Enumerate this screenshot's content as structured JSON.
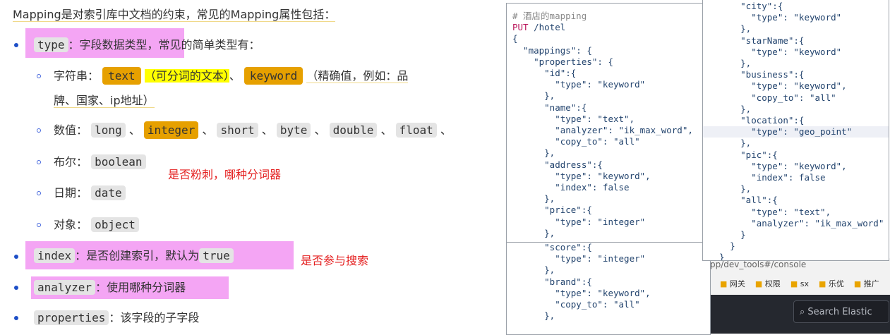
{
  "heading": "Mapping是对索引库中文档的约束，常见的Mapping属性包括：",
  "type_item": {
    "code": "type",
    "text": "：字段数据类型，常见的简单类型有："
  },
  "string_row": {
    "label": "字符串：",
    "text_code": "text",
    "text_note": "（可分词的文本）",
    "sep": "、",
    "keyword_code": "keyword",
    "keyword_note": "（精确值，例如：品",
    "keyword_note2": "牌、国家、ip地址）"
  },
  "number_row": {
    "label": "数值：",
    "types": [
      "long",
      "integer",
      "short",
      "byte",
      "double",
      "float"
    ],
    "sep": "、"
  },
  "bool_row": {
    "label": "布尔：",
    "code": "boolean",
    "note": "是否粉刺，哪种分词器"
  },
  "date_row": {
    "label": "日期：",
    "code": "date"
  },
  "object_row": {
    "label": "对象：",
    "code": "object"
  },
  "index_item": {
    "code": "index",
    "text": "：是否创建索引，默认为",
    "code2": "true",
    "note": "是否参与搜索"
  },
  "analyzer_item": {
    "code": "analyzer",
    "text": "：使用哪种分词器"
  },
  "properties_item": {
    "code": "properties",
    "text": "：该字段的子字段"
  },
  "code_left_top": {
    "comment": "# 酒店的mapping",
    "method": "PUT",
    "path": "/hotel",
    "lines": [
      "{",
      "  \"mappings\": {",
      "    \"properties\": {",
      "      \"id\":{",
      "        \"type\": \"keyword\"",
      "      },",
      "      \"name\":{",
      "        \"type\": \"text\",",
      "        \"analyzer\": \"ik_max_word\",",
      "        \"copy_to\": \"all\"",
      "      },",
      "      \"address\":{",
      "        \"type\": \"keyword\",",
      "        \"index\": false",
      "      },",
      "      \"price\":{",
      "        \"type\": \"integer\"",
      "      },"
    ]
  },
  "code_left_bottom": {
    "lines": [
      "      \"score\":{",
      "        \"type\": \"integer\"",
      "      },",
      "      \"brand\":{",
      "        \"type\": \"keyword\",",
      "        \"copy_to\": \"all\"",
      "      },"
    ]
  },
  "code_right": {
    "lines": [
      "      \"city\":{",
      "        \"type\": \"keyword\"",
      "      },",
      "      \"starName\":{",
      "        \"type\": \"keyword\"",
      "      },",
      "      \"business\":{",
      "        \"type\": \"keyword\",",
      "        \"copy_to\": \"all\"",
      "      },",
      "      \"location\":{",
      "        \"type\": \"geo_point\"",
      "      },",
      "      \"pic\":{",
      "        \"type\": \"keyword\",",
      "        \"index\": false",
      "      },",
      "      \"all\":{",
      "        \"type\": \"text\",",
      "        \"analyzer\": \"ik_max_word\"",
      "      }",
      "    }",
      "  }",
      "}"
    ]
  },
  "browser": {
    "url": "pp/dev_tools#/console",
    "bookmarks": [
      "网关",
      "权限",
      "sx",
      "乐优",
      "推广"
    ],
    "search_placeholder": "Search Elastic"
  }
}
